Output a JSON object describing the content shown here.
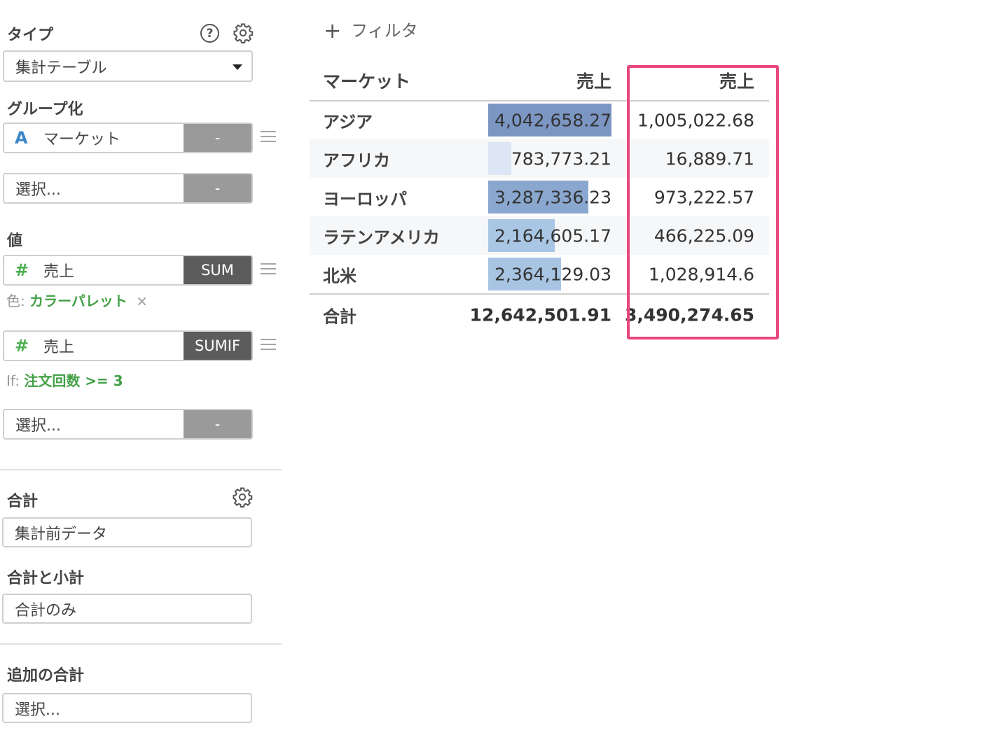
{
  "sidebar": {
    "type_section": {
      "title": "タイプ",
      "help_icon": "?",
      "selected": "集計テーブル"
    },
    "group_section": {
      "title": "グループ化",
      "field": {
        "type_icon": "A",
        "name": "マーケット",
        "action": "-"
      },
      "select": {
        "placeholder": "選択...",
        "action": "-"
      }
    },
    "value_section": {
      "title": "値",
      "value1": {
        "type_icon": "#",
        "name": "売上",
        "agg": "SUM",
        "meta_label": "色:",
        "meta_value": "カラーパレット",
        "remove": "×"
      },
      "value2": {
        "type_icon": "#",
        "name": "売上",
        "agg": "SUMIF",
        "meta_label": "If:",
        "meta_value": "注文回数 >= 3"
      },
      "select": {
        "placeholder": "選択...",
        "action": "-"
      }
    },
    "total_section": {
      "title": "合計",
      "value": "集計前データ"
    },
    "subtotal_section": {
      "title": "合計と小計",
      "value": "合計のみ"
    },
    "extra_total_section": {
      "title": "追加の合計",
      "value": "選択..."
    }
  },
  "main": {
    "filter": {
      "plus": "+",
      "label": "フィルタ"
    },
    "table": {
      "headers": [
        "マーケット",
        "売上",
        "売上"
      ],
      "rows": [
        {
          "market": "アジア",
          "sales_sum": "4,042,658.27",
          "sales_sumif": "1,005,022.68",
          "bar_fraction": 1.0,
          "bar_color": "#7c96c4"
        },
        {
          "market": "アフリカ",
          "sales_sum": "783,773.21",
          "sales_sumif": "16,889.71",
          "bar_fraction": 0.19,
          "bar_color": "#dde6f4"
        },
        {
          "market": "ヨーロッパ",
          "sales_sum": "3,287,336.23",
          "sales_sumif": "973,222.57",
          "bar_fraction": 0.81,
          "bar_color": "#8aa8cf"
        },
        {
          "market": "ラテンアメリカ",
          "sales_sum": "2,164,605.17",
          "sales_sumif": "466,225.09",
          "bar_fraction": 0.54,
          "bar_color": "#a9c7e4"
        },
        {
          "market": "北米",
          "sales_sum": "2,364,129.03",
          "sales_sumif": "1,028,914.6",
          "bar_fraction": 0.59,
          "bar_color": "#a7c5e3"
        }
      ],
      "total": {
        "label": "合計",
        "sales_sum": "12,642,501.91",
        "sales_sumif": "3,490,274.65"
      }
    },
    "highlight_color": "#e8487a"
  }
}
